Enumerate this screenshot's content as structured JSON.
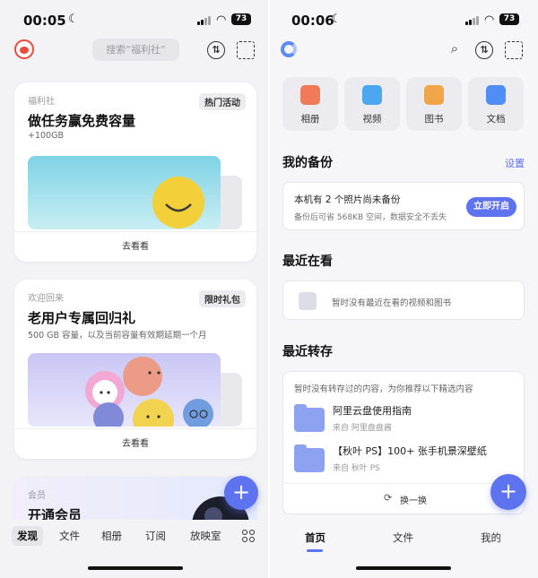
{
  "left": {
    "status": {
      "time": "00:05",
      "battery": "73"
    },
    "search_placeholder": "搜索“福利社”",
    "cards": [
      {
        "kicker": "福利社",
        "badge": "热门活动",
        "title": "做任务赢免费容量",
        "subtitle": "+100GB",
        "action": "去看看"
      },
      {
        "kicker": "欢迎回来",
        "badge": "限时礼包",
        "title": "老用户专属回归礼",
        "subtitle": "500 GB 容量，以及当前容量有效期延期一个月",
        "action": "去看看"
      },
      {
        "kicker": "会员",
        "title": "开通会员"
      }
    ],
    "tabs": [
      "发现",
      "文件",
      "相册",
      "订阅",
      "放映室"
    ],
    "fab": "+"
  },
  "right": {
    "status": {
      "time": "00:06",
      "battery": "73"
    },
    "quick": [
      {
        "label": "相册",
        "color": "#f07a5a"
      },
      {
        "label": "视频",
        "color": "#4aa7f0"
      },
      {
        "label": "图书",
        "color": "#f0a648"
      },
      {
        "label": "文档",
        "color": "#4f8ff5"
      }
    ],
    "backup": {
      "title": "我的备份",
      "settings": "设置",
      "line1": "本机有 2 个照片尚未备份",
      "line2": "备份后可省 568KB 空间，数据安全不丢失",
      "button": "立即开启"
    },
    "recent": {
      "title": "最近在看",
      "empty": "暂时没有最近在看的视频和图书"
    },
    "transfer": {
      "title": "最近转存",
      "hint": "暂时没有转存过的内容，为你推荐以下精选内容",
      "items": [
        {
          "name": "阿里云盘使用指南",
          "source": "来自 阿里盘盘酱"
        },
        {
          "name": "【秋叶 PS】100+ 张手机景深壁纸",
          "source": "来自 秋叶 PS"
        }
      ],
      "refresh": "换一换"
    },
    "tabs": [
      "首页",
      "文件",
      "我的"
    ],
    "fab": "+"
  },
  "accent": "#5e73f0"
}
